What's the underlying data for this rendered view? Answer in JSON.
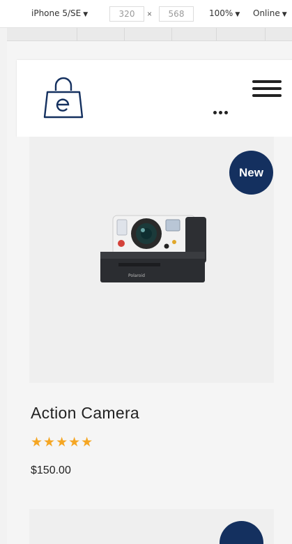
{
  "devtools": {
    "device": "iPhone 5/SE",
    "width": "320",
    "height": "568",
    "times": "×",
    "zoom": "100%",
    "network": "Online",
    "caret": "▼"
  },
  "header": {
    "logo_icon": "shopping-bag-e-icon",
    "menu_icon": "hamburger-menu-icon",
    "more_icon": "more-dots-icon"
  },
  "product": {
    "badge": "New",
    "title": "Action Camera",
    "rating": 5,
    "stars": "★★★★★",
    "price": "$150.00",
    "image_icon": "instant-camera-image"
  },
  "colors": {
    "badge": "#14305f",
    "stars": "#f5a623",
    "viewport_bg": "#f5f5f5",
    "image_bg": "#efefef"
  }
}
